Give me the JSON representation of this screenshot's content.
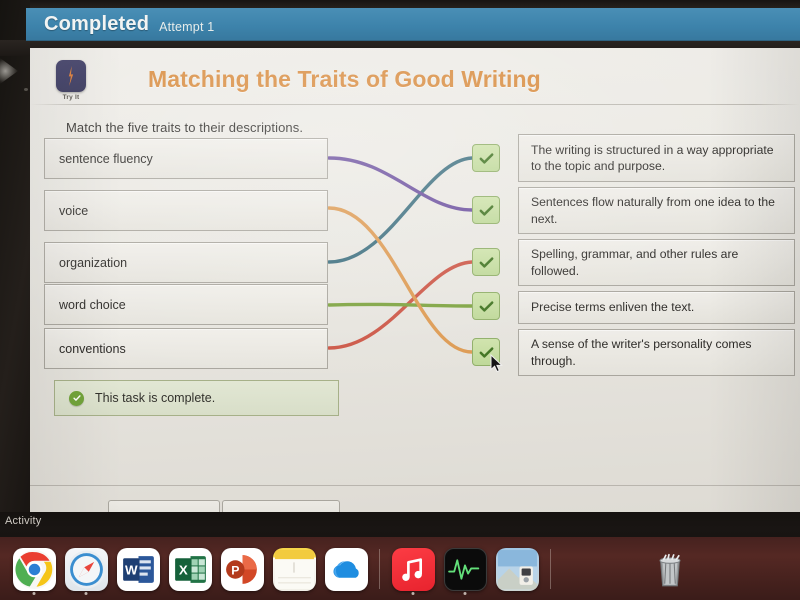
{
  "banner": {
    "status": "Completed",
    "attempt": "Attempt 1"
  },
  "activity": {
    "badge_label": "Try It",
    "badge_icon": "lightning-bolt-icon",
    "title": "Matching the Traits of Good Writing",
    "instructions": "Match the five traits to their descriptions.",
    "traits": [
      {
        "label": "sentence fluency",
        "line_color": "#6b4f9e"
      },
      {
        "label": "voice",
        "line_color": "#dd9a52"
      },
      {
        "label": "organization",
        "line_color": "#3d6f7f"
      },
      {
        "label": "word choice",
        "line_color": "#7da33f"
      },
      {
        "label": "conventions",
        "line_color": "#cc5646"
      }
    ],
    "descriptions": [
      {
        "text": "The writing is structured in a way appropriate to the topic and purpose.",
        "status_icon": "check-icon"
      },
      {
        "text": "Sentences flow naturally from one idea to the next.",
        "status_icon": "check-icon"
      },
      {
        "text": "Spelling, grammar, and other rules are followed.",
        "status_icon": "check-icon"
      },
      {
        "text": "Precise terms enliven the text.",
        "status_icon": "check-icon"
      },
      {
        "text": "A sense of the writer's personality comes through.",
        "status_icon": "check-icon"
      }
    ],
    "matches": [
      {
        "trait": "sentence fluency",
        "description_index": 1,
        "color": "#6b4f9e"
      },
      {
        "trait": "voice",
        "description_index": 4,
        "color": "#dd9a52"
      },
      {
        "trait": "organization",
        "description_index": 0,
        "color": "#3d6f7f"
      },
      {
        "trait": "word choice",
        "description_index": 3,
        "color": "#7da33f"
      },
      {
        "trait": "conventions",
        "description_index": 2,
        "color": "#cc5646"
      }
    ],
    "completion": {
      "text": "This task is complete.",
      "icon": "check-circle-icon",
      "color": "#72a43a"
    }
  },
  "desktop": {
    "tooltip": "Activity",
    "dock": [
      {
        "name": "Google Chrome",
        "icon": "chrome-icon"
      },
      {
        "name": "Safari",
        "icon": "safari-icon"
      },
      {
        "name": "Microsoft Word",
        "icon": "word-icon",
        "glyph": "W"
      },
      {
        "name": "Microsoft Excel",
        "icon": "excel-icon",
        "glyph": "X"
      },
      {
        "name": "Microsoft PowerPoint",
        "icon": "powerpoint-icon",
        "glyph": "P"
      },
      {
        "name": "Notes",
        "icon": "notes-icon"
      },
      {
        "name": "OneDrive",
        "icon": "onedrive-icon"
      },
      {
        "name": "Music",
        "icon": "music-icon"
      },
      {
        "name": "Activity Monitor",
        "icon": "activity-monitor-icon"
      },
      {
        "name": "Photos",
        "icon": "photos-icon"
      },
      {
        "name": "Trash",
        "icon": "trash-icon"
      }
    ]
  }
}
